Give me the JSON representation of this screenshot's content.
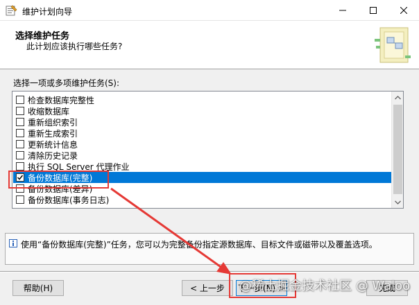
{
  "window": {
    "title": "维护计划向导",
    "minimize_icon": "minimize-icon",
    "maximize_icon": "maximize-icon",
    "close_icon": "close-icon"
  },
  "header": {
    "title": "选择维护任务",
    "subtitle": "此计划应该执行哪些任务?"
  },
  "task_list": {
    "label": "选择一项或多项维护任务(S):",
    "items": [
      {
        "label": "检查数据库完整性",
        "checked": false,
        "selected": false
      },
      {
        "label": "收缩数据库",
        "checked": false,
        "selected": false
      },
      {
        "label": "重新组织索引",
        "checked": false,
        "selected": false
      },
      {
        "label": "重新生成索引",
        "checked": false,
        "selected": false
      },
      {
        "label": "更新统计信息",
        "checked": false,
        "selected": false
      },
      {
        "label": "清除历史记录",
        "checked": false,
        "selected": false
      },
      {
        "label": "执行 SQL Server 代理作业",
        "checked": false,
        "selected": false
      },
      {
        "label": "备份数据库(完整)",
        "checked": true,
        "selected": true
      },
      {
        "label": "备份数据库(差异)",
        "checked": false,
        "selected": false
      },
      {
        "label": "备份数据库(事务日志)",
        "checked": false,
        "selected": false
      }
    ]
  },
  "info": {
    "text": "使用“备份数据库(完整)”任务，您可以为完整备份指定源数据库、目标文件或磁带以及覆盖选项。"
  },
  "buttons": {
    "help": "帮助(H)",
    "back": "< 上一步",
    "next": "下一步(N) >",
    "finish": "完成"
  },
  "watermark": "@稀土掘金技术社区 @ Waloo",
  "colors": {
    "selection": "#0078d7",
    "annotation_red": "#e53935"
  }
}
